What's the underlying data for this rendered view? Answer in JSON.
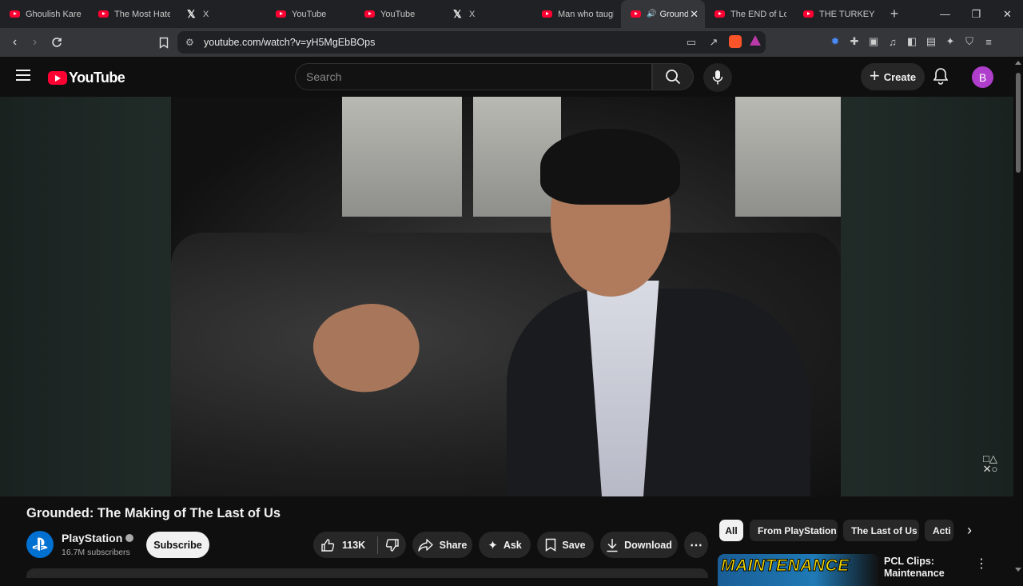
{
  "browser": {
    "tabs": [
      {
        "title": "Ghoulish Karen",
        "icon": "youtube-icon",
        "active": false
      },
      {
        "title": "The Most Hated",
        "icon": "youtube-icon",
        "active": false
      },
      {
        "title": "X",
        "icon": "x-icon",
        "active": false
      },
      {
        "title": "YouTube",
        "icon": "youtube-icon",
        "active": false
      },
      {
        "title": "YouTube",
        "icon": "youtube-icon",
        "active": false
      },
      {
        "title": "X",
        "icon": "x-icon",
        "active": false
      },
      {
        "title": "Man who taugh",
        "icon": "youtube-icon",
        "active": false
      },
      {
        "title": "Ground",
        "icon": "youtube-icon",
        "active": true
      },
      {
        "title": "The END of Lol",
        "icon": "youtube-icon",
        "active": false
      },
      {
        "title": "THE TURKEY TO",
        "icon": "youtube-icon",
        "active": false
      }
    ],
    "url": "youtube.com/watch?v=yH5MgEbBOps"
  },
  "youtube": {
    "logo_text": "YouTube",
    "search_placeholder": "Search",
    "create_label": "Create",
    "avatar_letter": "B"
  },
  "video": {
    "title": "Grounded: The Making of The Last of Us",
    "channel_name": "PlayStation",
    "subscribers": "16.7M subscribers",
    "subscribe_label": "Subscribe",
    "likes": "113K",
    "share_label": "Share",
    "ask_label": "Ask",
    "save_label": "Save",
    "download_label": "Download"
  },
  "chips": [
    "All",
    "From PlayStation",
    "The Last of Us",
    "Acti"
  ],
  "recommended": {
    "thumb_text": "MAINTENANCE",
    "title": "PCL Clips: Maintenance"
  },
  "colors": {
    "brand_red": "#ff0033",
    "background": "#0f0f0f",
    "avatar": "#b03ecc"
  }
}
